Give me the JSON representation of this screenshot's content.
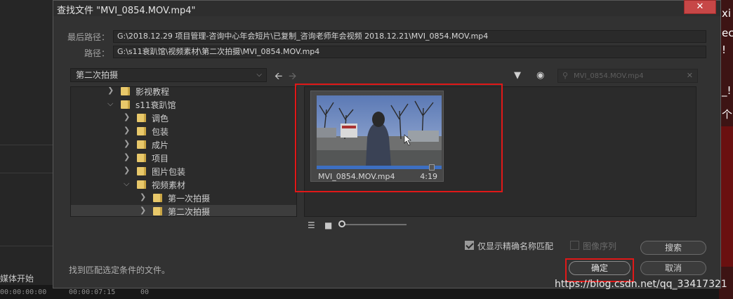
{
  "background": {
    "media_start_label": "媒体开始",
    "timecodes": [
      "00:00:00:00",
      "00:00:07:15",
      "00"
    ],
    "side_text": [
      "xi",
      "ec",
      "!",
      "_!",
      "个"
    ]
  },
  "dialog": {
    "title": "查找文件 \"MVI_0854.MOV.mp4\"",
    "close_label": "✕",
    "last_path_label": "最后路径：",
    "last_path_value": "G:\\2018.12.29 项目管理-咨询中心年会短片\\已复制_咨询老师年会视频 2018.12.21\\MVI_0854.MOV.mp4",
    "path_label": "路径：",
    "path_value": "G:\\s11衰趴馆\\视频素材\\第二次拍摄\\MVI_0854.MOV.mp4",
    "current_folder": "第二次拍摄",
    "search_placeholder": "MVI_0854.MOV.mp4",
    "tree": [
      {
        "label": "影视教程",
        "expanded": false
      },
      {
        "label": "s11衰趴馆",
        "expanded": true
      },
      {
        "label": "调色",
        "expanded": false
      },
      {
        "label": "包装",
        "expanded": false
      },
      {
        "label": "成片",
        "expanded": false
      },
      {
        "label": "项目",
        "expanded": false
      },
      {
        "label": "图片包装",
        "expanded": false
      },
      {
        "label": "视频素材",
        "expanded": true
      },
      {
        "label": "第一次拍摄",
        "expanded": false
      },
      {
        "label": "第二次拍摄",
        "expanded": false,
        "selected": true
      }
    ],
    "media": {
      "filename": "MVI_0854.MOV.mp4",
      "duration": "4:19",
      "playhead_fraction": 0.92
    },
    "exact_name_label": "仅显示精确名称匹配",
    "exact_name_checked": true,
    "image_sequence_label": "图像序列",
    "image_sequence_checked": false,
    "search_button": "搜索",
    "ok_button": "确定",
    "cancel_button": "取消",
    "status": "找到匹配选定条件的文件。"
  },
  "watermark": "https://blog.csdn.net/qq_33417321",
  "colors": {
    "dialog_bg": "#323232",
    "panel_bg": "#2b2b2b",
    "highlight": "#e01818",
    "folder": "#e8c86a",
    "scrub_bar": "#3d6fc2"
  }
}
